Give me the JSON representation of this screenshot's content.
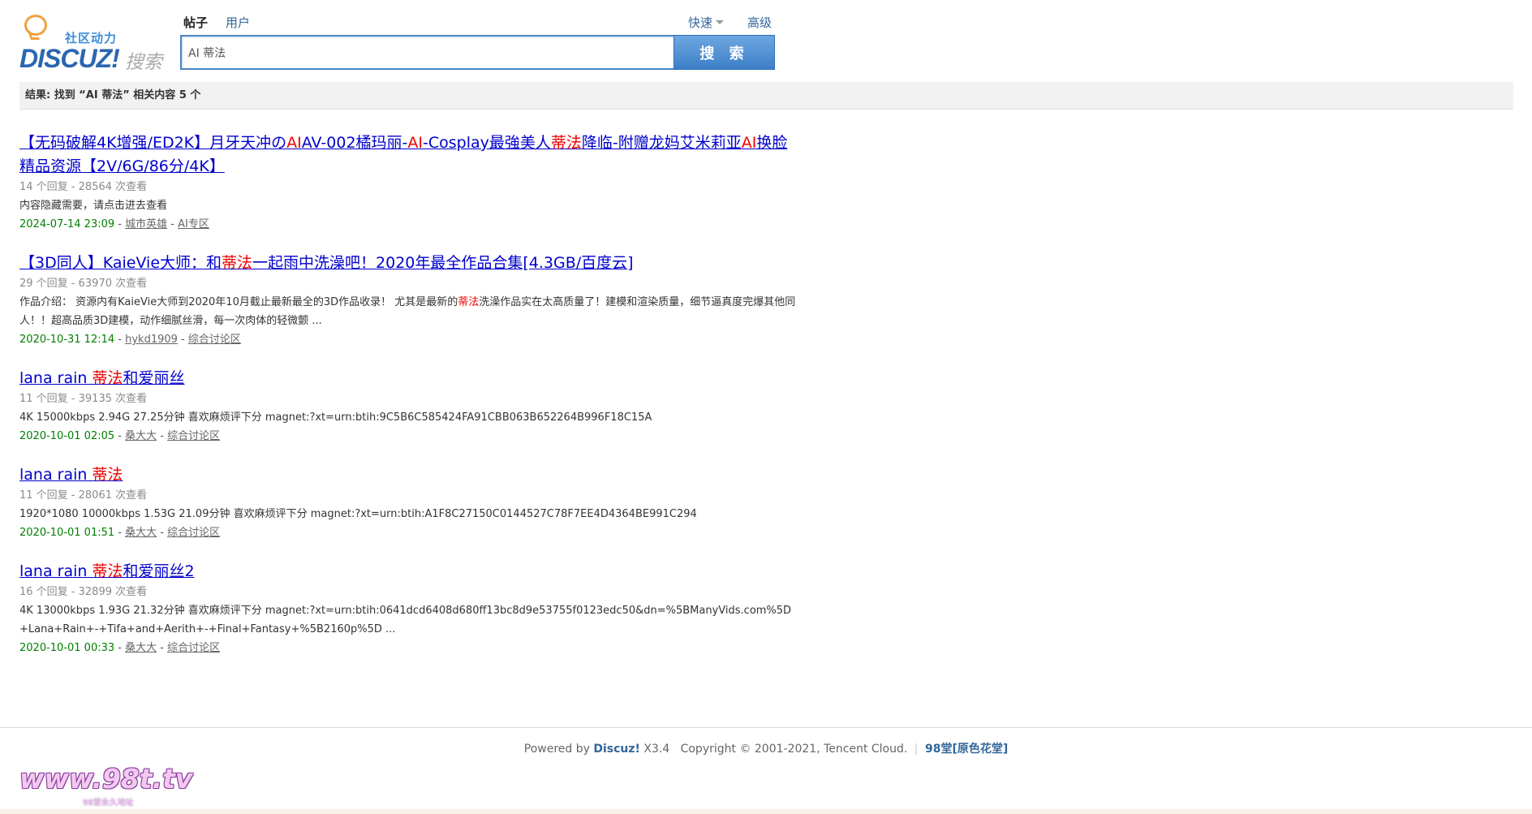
{
  "logo": {
    "tagline": "社区动力",
    "brand": "DISCUZ!",
    "suffix": "搜索"
  },
  "search": {
    "tabs": [
      {
        "label": "帖子",
        "active": true
      },
      {
        "label": "用户",
        "active": false
      }
    ],
    "quick_label": "快速",
    "advanced_label": "高级",
    "query": "AI 蒂法",
    "button_label": "搜 索"
  },
  "result_bar": {
    "text": "结果: 找到 “AI 蒂法” 相关内容 5 个"
  },
  "results": [
    {
      "title_parts": [
        {
          "t": "【无码破解4K增强/ED2K】月牙天冲の",
          "hl": false
        },
        {
          "t": "AI",
          "hl": true
        },
        {
          "t": "AV-002橘玛丽-",
          "hl": false
        },
        {
          "t": "AI",
          "hl": true
        },
        {
          "t": "-Cosplay最強美人",
          "hl": false
        },
        {
          "t": "蒂法",
          "hl": true
        },
        {
          "t": "降临-附赠龙妈艾米莉亚",
          "hl": false
        },
        {
          "t": "AI",
          "hl": true
        },
        {
          "t": "换脸精品资源【2V/6G/86分/4K】",
          "hl": false
        }
      ],
      "stats": "14 个回复 - 28564 次查看",
      "snippet_parts": [
        {
          "t": "内容隐藏需要，请点击进去查看",
          "hl": false
        }
      ],
      "date": "2024-07-14 23:09",
      "author": "城市英雄",
      "forum": "AI专区"
    },
    {
      "title_parts": [
        {
          "t": "【3D同人】KaieVie大师：和",
          "hl": false
        },
        {
          "t": "蒂法",
          "hl": true
        },
        {
          "t": "一起雨中洗澡吧！2020年最全作品合集[4.3GB/百度云]",
          "hl": false
        }
      ],
      "stats": "29 个回复 - 63970 次查看",
      "snippet_parts": [
        {
          "t": "作品介绍： 资源内有KaieVie大师到2020年10月截止最新最全的3D作品收录！ 尤其是最新的",
          "hl": false
        },
        {
          "t": "蒂法",
          "hl": true
        },
        {
          "t": "洗澡作品实在太高质量了！建模和渲染质量，细节逼真度完爆其他同人！！超高品质3D建模，动作细腻丝滑，每一次肉体的轻微颤 ...",
          "hl": false
        }
      ],
      "date": "2020-10-31 12:14",
      "author": "hykd1909",
      "forum": "综合讨论区"
    },
    {
      "title_parts": [
        {
          "t": "lana rain ",
          "hl": false
        },
        {
          "t": "蒂法",
          "hl": true
        },
        {
          "t": "和爱丽丝",
          "hl": false
        }
      ],
      "stats": "11 个回复 - 39135 次查看",
      "snippet_parts": [
        {
          "t": "4K 15000kbps 2.94G 27.25分钟 喜欢麻烦评下分 magnet:?xt=urn:btih:9C5B6C585424FA91CBB063B652264B996F18C15A",
          "hl": false
        }
      ],
      "date": "2020-10-01 02:05",
      "author": "桑大大",
      "forum": "综合讨论区"
    },
    {
      "title_parts": [
        {
          "t": "lana rain ",
          "hl": false
        },
        {
          "t": "蒂法",
          "hl": true
        }
      ],
      "stats": "11 个回复 - 28061 次查看",
      "snippet_parts": [
        {
          "t": "1920*1080 10000kbps 1.53G 21.09分钟 喜欢麻烦评下分 magnet:?xt=urn:btih:A1F8C27150C0144527C78F7EE4D4364BE991C294",
          "hl": false
        }
      ],
      "date": "2020-10-01 01:51",
      "author": "桑大大",
      "forum": "综合讨论区"
    },
    {
      "title_parts": [
        {
          "t": "lana rain ",
          "hl": false
        },
        {
          "t": "蒂法",
          "hl": true
        },
        {
          "t": "和爱丽丝2",
          "hl": false
        }
      ],
      "stats": "16 个回复 - 32899 次查看",
      "snippet_parts": [
        {
          "t": "4K 13000kbps 1.93G 21.32分钟 喜欢麻烦评下分 magnet:?xt=urn:btih:0641dcd6408d680ff13bc8d9e53755f0123edc50&dn=%5BManyVids.com%5D+Lana+Rain+-+Tifa+and+Aerith+-+Final+Fantasy+%5B2160p%5D ...",
          "hl": false
        }
      ],
      "date": "2020-10-01 00:33",
      "author": "桑大大",
      "forum": "综合讨论区"
    }
  ],
  "footer": {
    "powered_by": "Powered by",
    "brand": "Discuz!",
    "version": "X3.4",
    "copyright": "Copyright © 2001-2021, Tencent Cloud.",
    "separator": "|",
    "site_name": "98堂[原色花堂]"
  },
  "watermark": {
    "url": "www.98t.tv",
    "sub": "98堂永久地址"
  },
  "colors": {
    "link": "#0000cc",
    "highlight": "#ee0000",
    "date": "#008000",
    "accent": "#336699"
  }
}
